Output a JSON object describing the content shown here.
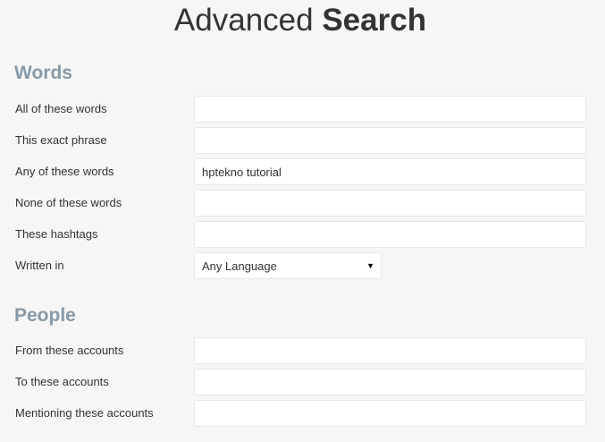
{
  "header": {
    "title_light": "Advanced",
    "title_bold": "Search"
  },
  "sections": {
    "words": {
      "title": "Words",
      "all_words": {
        "label": "All of these words",
        "value": ""
      },
      "exact_phrase": {
        "label": "This exact phrase",
        "value": ""
      },
      "any_words": {
        "label": "Any of these words",
        "value": "hptekno tutorial"
      },
      "none_words": {
        "label": "None of these words",
        "value": ""
      },
      "hashtags": {
        "label": "These hashtags",
        "value": ""
      },
      "language": {
        "label": "Written in",
        "selected": "Any Language",
        "arrow_icon": "dropdown-triangle"
      }
    },
    "people": {
      "title": "People",
      "from_accounts": {
        "label": "From these accounts",
        "value": ""
      },
      "to_accounts": {
        "label": "To these accounts",
        "value": ""
      },
      "mentioning_accounts": {
        "label": "Mentioning these accounts",
        "value": ""
      }
    }
  },
  "colors": {
    "background": "#f6f6f6",
    "section_title": "#8899a6",
    "input_border": "#e1e8ed",
    "text": "#333333"
  }
}
